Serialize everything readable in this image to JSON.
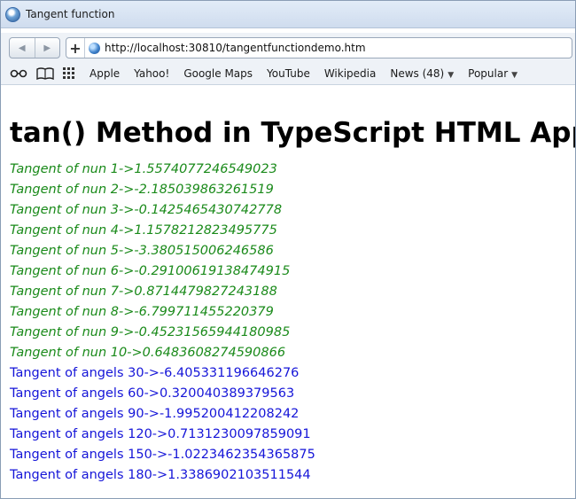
{
  "window": {
    "title": "Tangent function"
  },
  "toolbar": {
    "url": "http://localhost:30810/tangentfunctiondemo.htm"
  },
  "bookmarks": {
    "items": [
      "Apple",
      "Yahoo!",
      "Google Maps",
      "YouTube",
      "Wikipedia",
      "News (48)",
      "Popular"
    ]
  },
  "page": {
    "heading": "tan() Method in TypeScript HTML App",
    "tangent_nums": [
      "Tangent of nun 1->1.5574077246549023",
      "Tangent of nun 2->-2.185039863261519",
      "Tangent of nun 3->-0.1425465430742778",
      "Tangent of nun 4->1.1578212823495775",
      "Tangent of nun 5->-3.380515006246586",
      "Tangent of nun 6->-0.29100619138474915",
      "Tangent of nun 7->0.8714479827243188",
      "Tangent of nun 8->-6.799711455220379",
      "Tangent of nun 9->-0.45231565944180985",
      "Tangent of nun 10->0.6483608274590866"
    ],
    "tangent_angles": [
      "Tangent of angels 30->-6.405331196646276",
      "Tangent of angels 60->0.320040389379563",
      "Tangent of angels 90->-1.995200412208242",
      "Tangent of angels 120->0.7131230097859091",
      "Tangent of angels 150->-1.0223462354365875",
      "Tangent of angels 180->1.3386902103511544"
    ]
  }
}
